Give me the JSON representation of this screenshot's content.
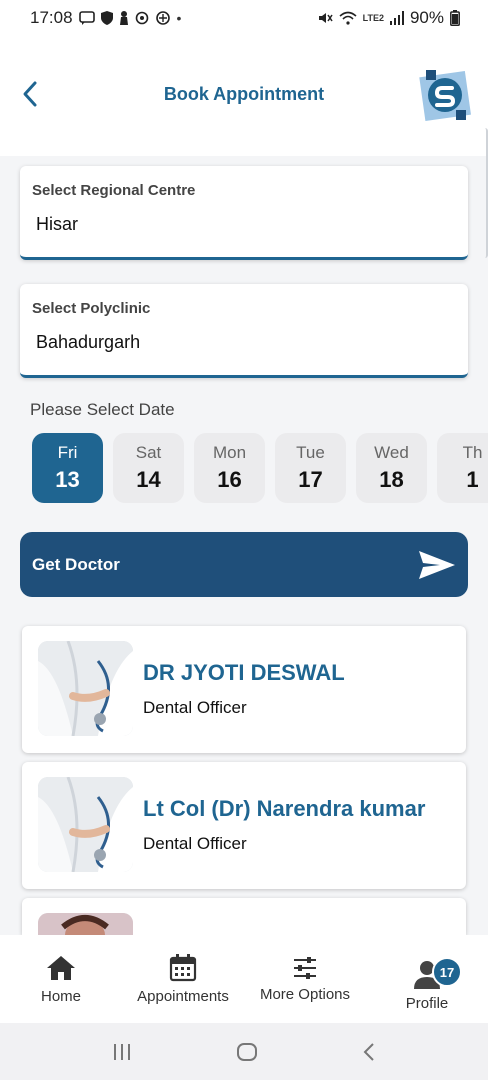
{
  "status_bar": {
    "time": "17:08",
    "network": "LTE2",
    "battery": "90%"
  },
  "header": {
    "title": "Book Appointment",
    "back_icon": "chevron-left-icon",
    "logo_icon": "app-logo-icon"
  },
  "regional_centre": {
    "label": "Select Regional Centre",
    "value": "Hisar"
  },
  "polyclinic": {
    "label": "Select Polyclinic",
    "value": "Bahadurgarh"
  },
  "date_picker": {
    "heading": "Please Select Date",
    "dates": [
      {
        "dow": "Fri",
        "day": "13",
        "selected": true
      },
      {
        "dow": "Sat",
        "day": "14",
        "selected": false
      },
      {
        "dow": "Mon",
        "day": "16",
        "selected": false
      },
      {
        "dow": "Tue",
        "day": "17",
        "selected": false
      },
      {
        "dow": "Wed",
        "day": "18",
        "selected": false
      },
      {
        "dow": "Th",
        "day": "1",
        "selected": false
      }
    ]
  },
  "get_doctor": {
    "label": "Get Doctor",
    "icon": "send-icon"
  },
  "doctors": [
    {
      "name": "DR JYOTI DESWAL",
      "role": "Dental Officer"
    },
    {
      "name": "Lt Col (Dr) Narendra kumar",
      "role": "Dental Officer"
    },
    {
      "name": "",
      "role": ""
    }
  ],
  "bottom_nav": {
    "items": [
      {
        "label": "Home",
        "icon": "home-icon"
      },
      {
        "label": "Appointments",
        "icon": "calendar-icon"
      },
      {
        "label": "More Options",
        "icon": "sliders-icon"
      },
      {
        "label": "Profile",
        "icon": "user-icon",
        "badge": "17"
      }
    ]
  },
  "colors": {
    "primary": "#1f6591",
    "button": "#1f4f7a"
  }
}
